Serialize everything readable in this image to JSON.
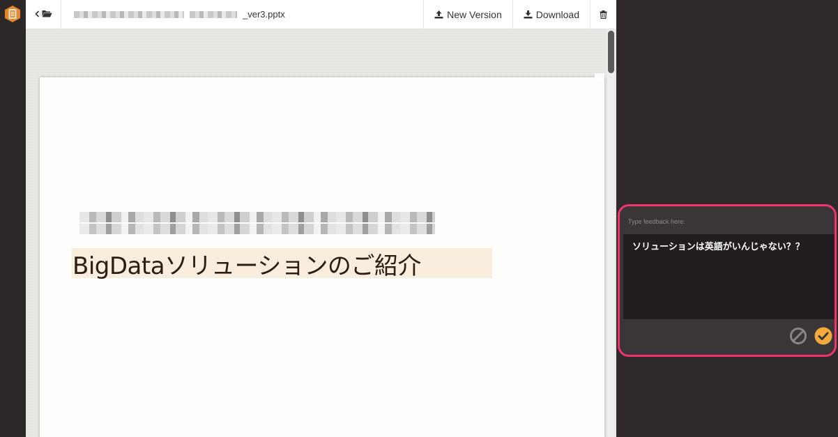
{
  "app": {
    "logo_icon": "document-hexagon-icon",
    "accent_color": "#f08a24"
  },
  "toolbar": {
    "back_icon": "chevron-left-icon",
    "folder_icon": "folder-open-icon",
    "filename_suffix": "_ver3.pptx",
    "new_version_label": "New Version",
    "new_version_icon": "upload-icon",
    "download_label": "Download",
    "download_icon": "download-icon",
    "delete_icon": "trash-icon"
  },
  "slide": {
    "title": "BigDataソリューションのご紹介",
    "title_highlight_color": "#f9eedd"
  },
  "feedback": {
    "label": "Type feedback here:",
    "text": "ソリューションは英語がいんじゃない？？",
    "cancel_icon": "cancel-circle-icon",
    "confirm_icon": "check-circle-icon",
    "border_color": "#f2346c",
    "confirm_color": "#f3a93c"
  }
}
